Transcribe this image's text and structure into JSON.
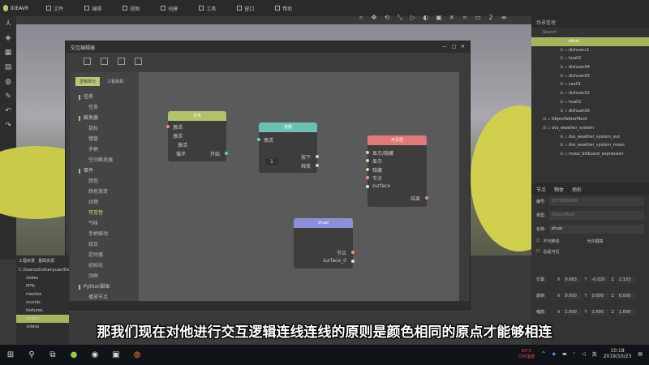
{
  "app": {
    "name": "IDEAVR",
    "menu": [
      "文件",
      "编辑",
      "视图",
      "创建",
      "工具",
      "窗口",
      "帮助"
    ],
    "toolbar_number": "2"
  },
  "dialog": {
    "title": "交互编辑器",
    "tabs": [
      "逻辑单元",
      "工程资源"
    ],
    "tree": [
      {
        "label": "任务",
        "type": "cat"
      },
      {
        "label": "任务",
        "type": "sub"
      },
      {
        "label": "触发器",
        "type": "cat"
      },
      {
        "label": "鼠标",
        "type": "sub"
      },
      {
        "label": "键盘",
        "type": "sub"
      },
      {
        "label": "手柄",
        "type": "sub"
      },
      {
        "label": "空间触发器",
        "type": "sub"
      },
      {
        "label": "事件",
        "type": "cat"
      },
      {
        "label": "颜色",
        "type": "sub"
      },
      {
        "label": "颜色渐变",
        "type": "sub"
      },
      {
        "label": "纹理",
        "type": "sub"
      },
      {
        "label": "可见性",
        "type": "sub",
        "hl": true
      },
      {
        "label": "气味",
        "type": "sub"
      },
      {
        "label": "手柄振动",
        "type": "sub"
      },
      {
        "label": "组合",
        "type": "sub"
      },
      {
        "label": "定时器",
        "type": "sub"
      },
      {
        "label": "初始化",
        "type": "sub"
      },
      {
        "label": "动画",
        "type": "sub"
      },
      {
        "label": "Python脚本",
        "type": "cat"
      },
      {
        "label": "播放节点",
        "type": "sub"
      }
    ],
    "nodes": {
      "green": {
        "title": "任务",
        "rows": [
          "激活",
          "激活",
          "激活",
          "循环"
        ],
        "out": "开始"
      },
      "teal": {
        "title": "按键",
        "in": "激活",
        "value": "1",
        "outs": [
          "按下",
          "释放"
        ]
      },
      "red": {
        "title": "可见性",
        "ins": [
          "显示/隐藏",
          "显示",
          "隐藏",
          "节点",
          "surface"
        ],
        "out": "结束"
      },
      "purple": {
        "title": "shuai",
        "outs": [
          "节点",
          "surface_0"
        ]
      }
    }
  },
  "scene": {
    "title": "场景管理",
    "search": "Search",
    "items": [
      "shuai",
      "dizhuanc1",
      "hua02",
      "dizhuan04",
      "dizhuan05",
      "cao01",
      "dizhuan02",
      "hua01",
      "dizhuan06",
      "ObjectWaterMesh",
      "dvs_weather_system",
      "dvs_weather_system_sun",
      "dvs_weather_system_moon",
      "mooo_billboard_expression"
    ]
  },
  "props": {
    "tabs": [
      "节点",
      "物体",
      "地形"
    ],
    "fields": [
      {
        "label": "编号:",
        "value": "1572859428"
      },
      {
        "label": "类型:",
        "value": "ObjectMesh"
      },
      {
        "label": "名称:",
        "value": "shuai"
      }
    ],
    "checks": [
      "不可移动",
      "允许碰撞",
      "总是可见"
    ],
    "transform": [
      {
        "label": "位置:",
        "x": "0.063",
        "y": "-0.020",
        "z": "2.133"
      },
      {
        "label": "旋转:",
        "x": "0.000",
        "y": "0.000",
        "z": "0.000"
      },
      {
        "label": "缩放:",
        "x": "1.000",
        "y": "1.000",
        "z": "1.000"
      }
    ]
  },
  "project": {
    "tabs": [
      "工程目录",
      "基础资源"
    ],
    "path": "C:/Users/zhizhanyuan/De",
    "items": [
      "nodes",
      "PPTs",
      "meshes",
      "sounds",
      "textures",
      "scripts",
      "videos"
    ]
  },
  "subtitle": "那我们现在对他进行交互逻辑连线连线的原则是颜色相同的原点才能够相连",
  "taskbar": {
    "temp": "80°C",
    "cpu": "CPU温度",
    "ime": "英",
    "time": "10:18",
    "date": "2019/10/23"
  }
}
